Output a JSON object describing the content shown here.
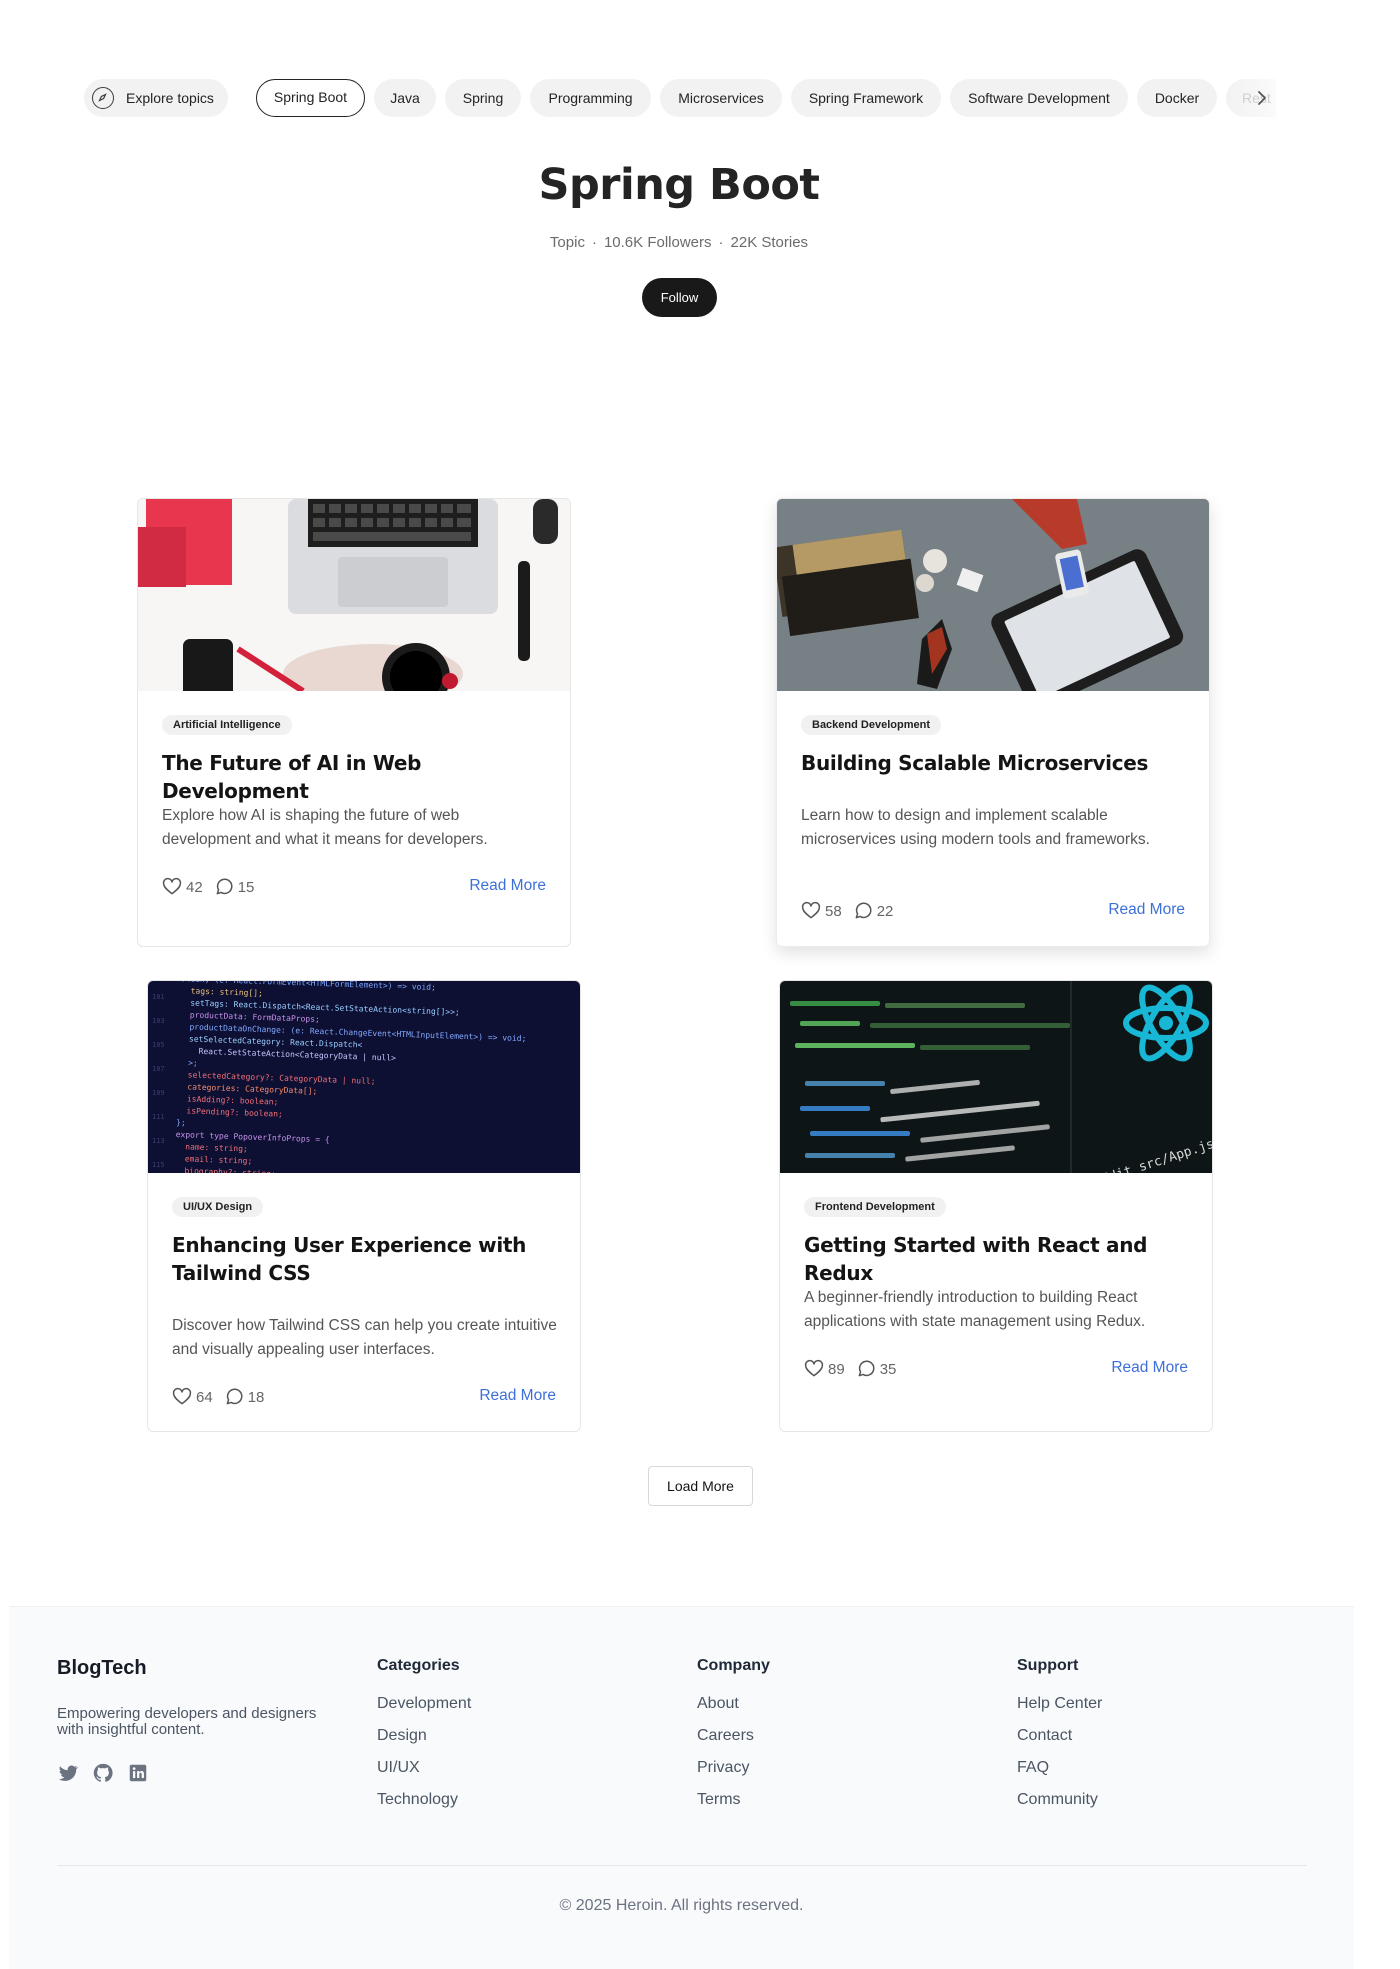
{
  "topics": {
    "explore_label": "Explore topics",
    "items": [
      {
        "label": "Spring Boot",
        "active": true
      },
      {
        "label": "Java"
      },
      {
        "label": "Spring"
      },
      {
        "label": "Programming"
      },
      {
        "label": "Microservices"
      },
      {
        "label": "Spring Framework"
      },
      {
        "label": "Software Development"
      },
      {
        "label": "Docker"
      },
      {
        "label": "Rest"
      }
    ]
  },
  "header": {
    "title": "Spring Boot",
    "type": "Topic",
    "followers": "10.6K Followers",
    "stories": "22K Stories",
    "follow_label": "Follow"
  },
  "articles": [
    {
      "category": "Artificial Intelligence",
      "title": "The Future of AI in Web Development",
      "description": "Explore how AI is shaping the future of web development and what it means for developers.",
      "likes": "42",
      "comments": "15",
      "link_label": "Read More"
    },
    {
      "category": "Backend Development",
      "title": "Building Scalable Microservices",
      "description": "Learn how to design and implement scalable microservices using modern tools and frameworks.",
      "likes": "58",
      "comments": "22",
      "link_label": "Read More"
    },
    {
      "category": "UI/UX Design",
      "title": "Enhancing User Experience with Tailwind CSS",
      "description": "Discover how Tailwind CSS can help you create intuitive and visually appealing user interfaces.",
      "likes": "64",
      "comments": "18",
      "link_label": "Read More"
    },
    {
      "category": "Frontend Development",
      "title": "Getting Started with React and Redux",
      "description": "A beginner-friendly introduction to building React applications with state management using Redux.",
      "likes": "89",
      "comments": "35",
      "link_label": "Read More"
    }
  ],
  "load_more_label": "Load More",
  "footer": {
    "brand": "BlogTech",
    "tagline": "Empowering developers and designers with insightful content.",
    "social_icons": [
      "twitter-icon",
      "github-icon",
      "linkedin-icon"
    ],
    "columns": [
      {
        "title": "Categories",
        "links": [
          "Development",
          "Design",
          "UI/UX",
          "Technology"
        ]
      },
      {
        "title": "Company",
        "links": [
          "About",
          "Careers",
          "Privacy",
          "Terms"
        ]
      },
      {
        "title": "Support",
        "links": [
          "Help Center",
          "Contact",
          "FAQ",
          "Community"
        ]
      }
    ],
    "copyright": "© 2025 Heroin. All rights reserved."
  },
  "colors": {
    "link": "#3d6fd8",
    "follow_button": "#191919",
    "footer_bg": "#f9fafb"
  }
}
